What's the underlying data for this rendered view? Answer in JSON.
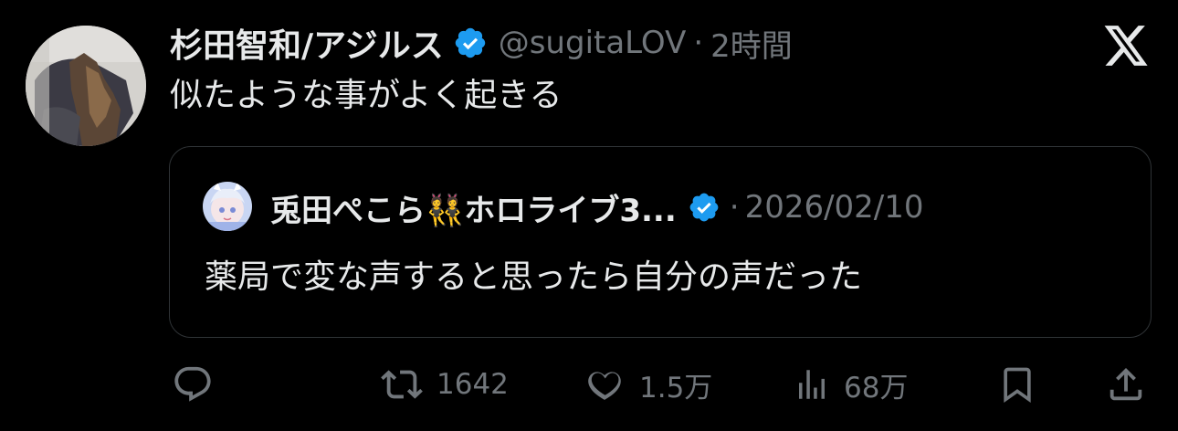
{
  "tweet": {
    "display_name": "杉田智和/アジルス",
    "handle": "@sugitaLOV",
    "separator": "·",
    "time": "2時間",
    "text": "似たような事がよく起きる"
  },
  "quote": {
    "display_name": "兎田ぺこら👯ホロライブ3...",
    "separator": "·",
    "date": "2026/02/10",
    "text": "薬局で変な声すると思ったら自分の声だった"
  },
  "actions": {
    "reply": {
      "icon": "reply-icon"
    },
    "retweet": {
      "icon": "retweet-icon",
      "count": "1642"
    },
    "like": {
      "icon": "heart-icon",
      "count": "1.5万"
    },
    "views": {
      "icon": "views-icon",
      "count": "68万"
    },
    "bookmark": {
      "icon": "bookmark-icon"
    },
    "share": {
      "icon": "share-icon"
    }
  },
  "colors": {
    "background": "#000000",
    "text": "#e7e9ea",
    "muted": "#71767b",
    "verified": "#1d9bf0",
    "border": "#2f3336"
  }
}
